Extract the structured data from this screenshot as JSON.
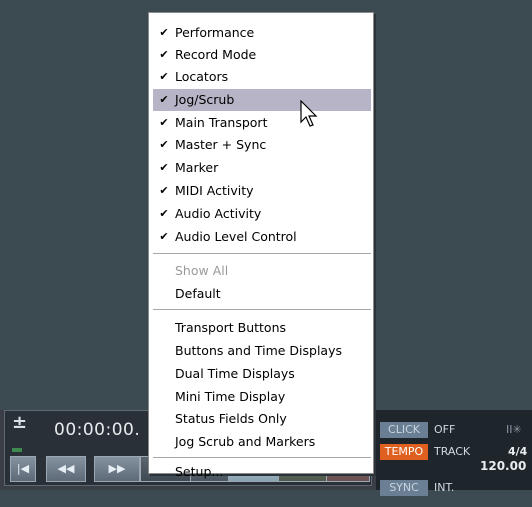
{
  "menu": {
    "checked_items": [
      {
        "label": "Performance"
      },
      {
        "label": "Record Mode"
      },
      {
        "label": "Locators"
      },
      {
        "label": "Jog/Scrub"
      },
      {
        "label": "Main Transport"
      },
      {
        "label": "Master + Sync"
      },
      {
        "label": "Marker"
      },
      {
        "label": "MIDI Activity"
      },
      {
        "label": "Audio Activity"
      },
      {
        "label": "Audio Level Control"
      }
    ],
    "check_glyph": "✔",
    "show_all": "Show All",
    "default": "Default",
    "presets": [
      {
        "label": "Transport Buttons"
      },
      {
        "label": "Buttons and Time Displays"
      },
      {
        "label": "Dual Time Displays"
      },
      {
        "label": "Mini Time Display"
      },
      {
        "label": "Status Fields Only"
      },
      {
        "label": "Jog Scrub and Markers"
      }
    ],
    "setup": "Setup...",
    "highlighted_item": "Jog/Scrub"
  },
  "transport": {
    "plus": "±",
    "time_display": "00:00:00.",
    "buttons": [
      {
        "icon": "go-to-start-icon",
        "glyph": "|◀"
      },
      {
        "icon": "rewind-icon",
        "glyph": "◀◀"
      },
      {
        "icon": "fast-forward-icon",
        "glyph": "▶▶"
      }
    ]
  },
  "status": {
    "click_tag": "CLICK",
    "click_value": "OFF",
    "tempo_tag": "TEMPO",
    "tempo_value": "TRACK",
    "signature": "4/4",
    "tempo_number": "120.00",
    "sync_tag": "SYNC",
    "sync_value": "INT.",
    "clock_glyph": "II✳"
  },
  "colors": {
    "background": "#3c4a52",
    "highlight": "#b6b4c6",
    "tempo_tag": "#e06020",
    "click_tag": "#6a7f94",
    "sync_tag": "#6a7f94"
  }
}
